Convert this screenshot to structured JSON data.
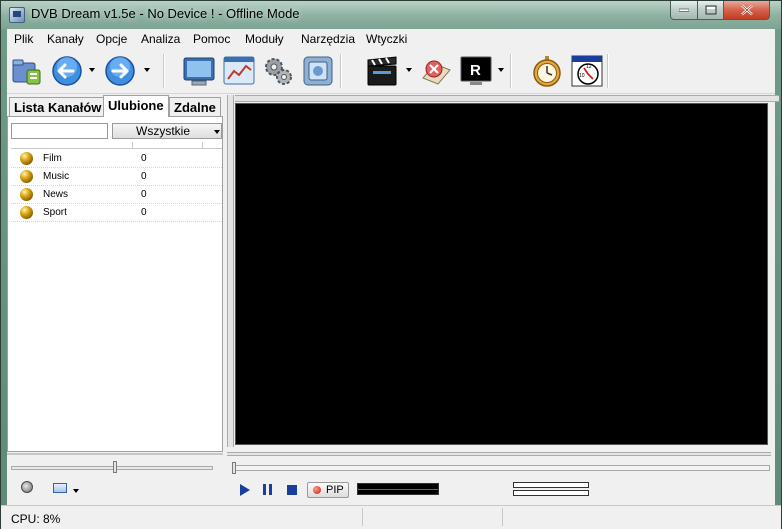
{
  "window": {
    "title": "DVB Dream v1.5e - No Device ! - Offline Mode"
  },
  "menu": [
    "Plik",
    "Kanały",
    "Opcje",
    "Analiza",
    "Pomoc",
    "Moduły",
    "Narzędzia",
    "Wtyczki"
  ],
  "tabs": {
    "channel_list": "Lista Kanałów",
    "favorites": "Ulubione",
    "remote": "Zdalne"
  },
  "filter": {
    "search_value": "",
    "group_select": "Wszystkie"
  },
  "favorites": [
    {
      "name": "Film",
      "count": "0"
    },
    {
      "name": "Music",
      "count": "0"
    },
    {
      "name": "News",
      "count": "0"
    },
    {
      "name": "Sport",
      "count": "0"
    }
  ],
  "playback": {
    "pip_label": "PIP"
  },
  "status": {
    "cpu": "CPU: 8%"
  },
  "colors": {
    "video_bg": "#000000",
    "accent_blue": "#1b3d9b",
    "record_red": "#d0170a"
  }
}
